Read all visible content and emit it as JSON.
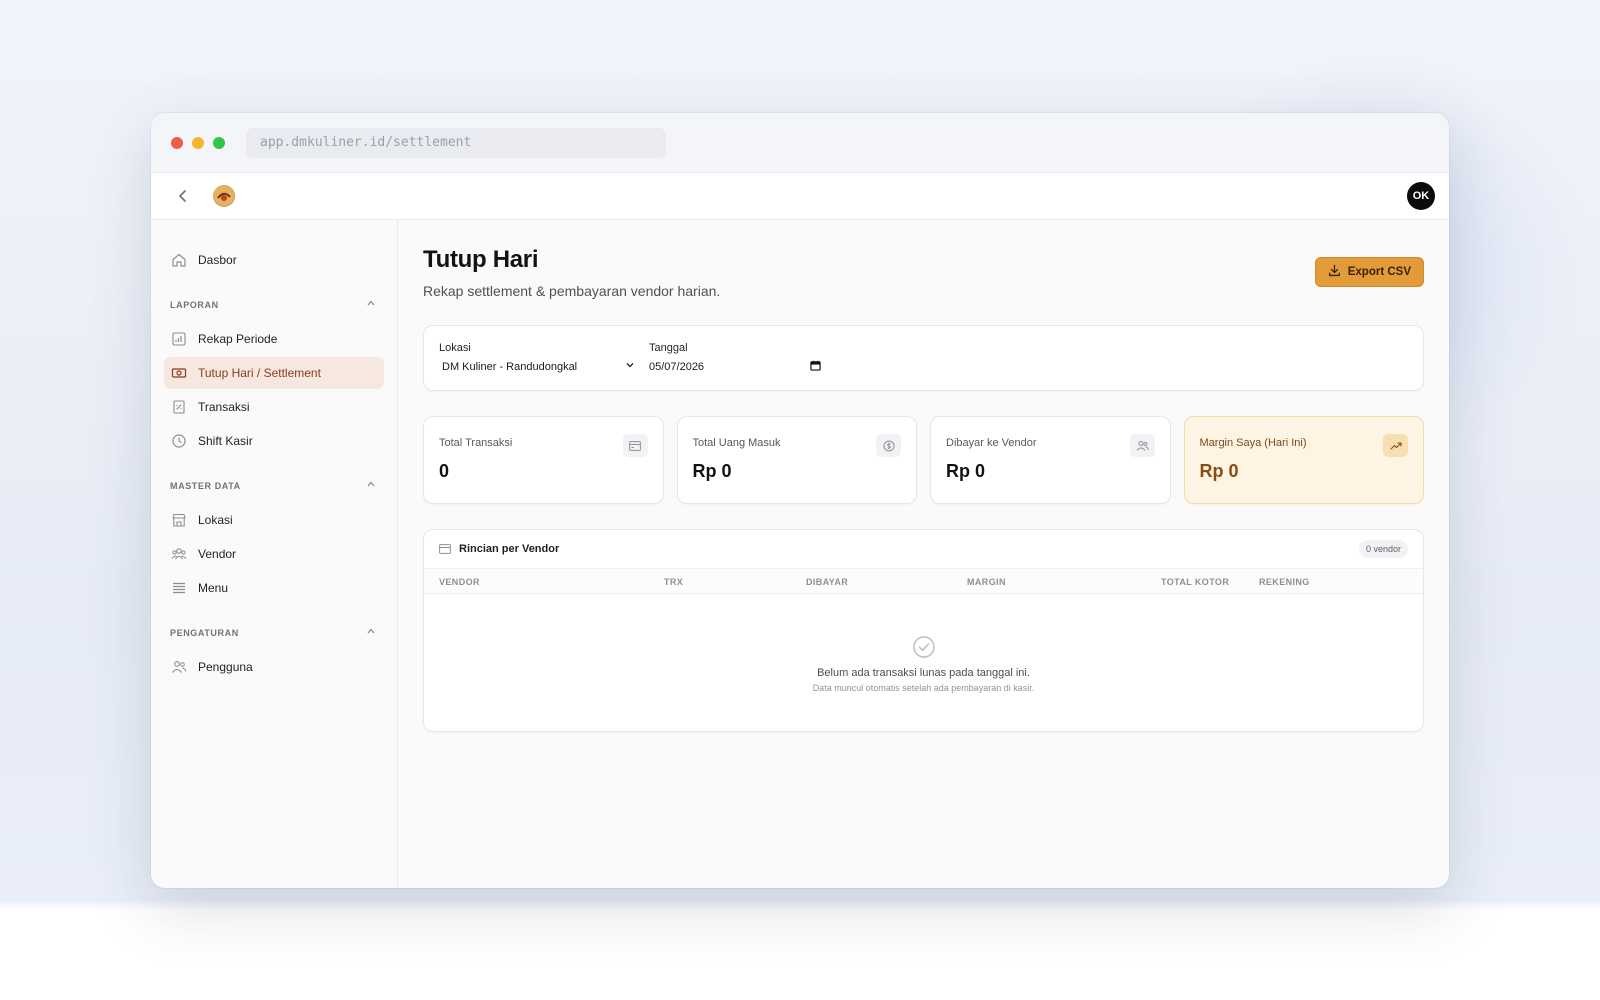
{
  "browser": {
    "url": "app.dmkuliner.id/settlement"
  },
  "topbar": {
    "avatar_initials": "OK"
  },
  "sidebar": {
    "dashboard": "Dasbor",
    "sections": [
      {
        "title": "LAPORAN",
        "items": [
          "Rekap Periode",
          "Tutup Hari / Settlement",
          "Transaksi",
          "Shift Kasir"
        ]
      },
      {
        "title": "MASTER DATA",
        "items": [
          "Lokasi",
          "Vendor",
          "Menu"
        ]
      },
      {
        "title": "PENGATURAN",
        "items": [
          "Pengguna"
        ]
      }
    ]
  },
  "page": {
    "title": "Tutup Hari",
    "subtitle": "Rekap settlement & pembayaran vendor harian.",
    "export_label": "Export CSV"
  },
  "filters": {
    "location_label": "Lokasi",
    "location_value": "DM Kuliner - Randudongkal",
    "date_label": "Tanggal",
    "date_value": "05/07/2026"
  },
  "stats": [
    {
      "label": "Total Transaksi",
      "value": "0"
    },
    {
      "label": "Total Uang Masuk",
      "value": "Rp 0"
    },
    {
      "label": "Dibayar ke Vendor",
      "value": "Rp 0"
    },
    {
      "label": "Margin Saya (Hari Ini)",
      "value": "Rp 0"
    }
  ],
  "vendor_table": {
    "title": "Rincian per Vendor",
    "count": "0 vendor",
    "columns": [
      "VENDOR",
      "TRX",
      "DIBAYAR",
      "MARGIN",
      "TOTAL KOTOR",
      "REKENING"
    ],
    "empty_title": "Belum ada transaksi lunas pada tanggal ini.",
    "empty_sub": "Data muncul otomatis setelah ada pembayaran di kasir."
  },
  "colors": {
    "accent": "#e39a38",
    "active_bg": "#f6e7e0",
    "active_text": "#8a3d1e"
  }
}
